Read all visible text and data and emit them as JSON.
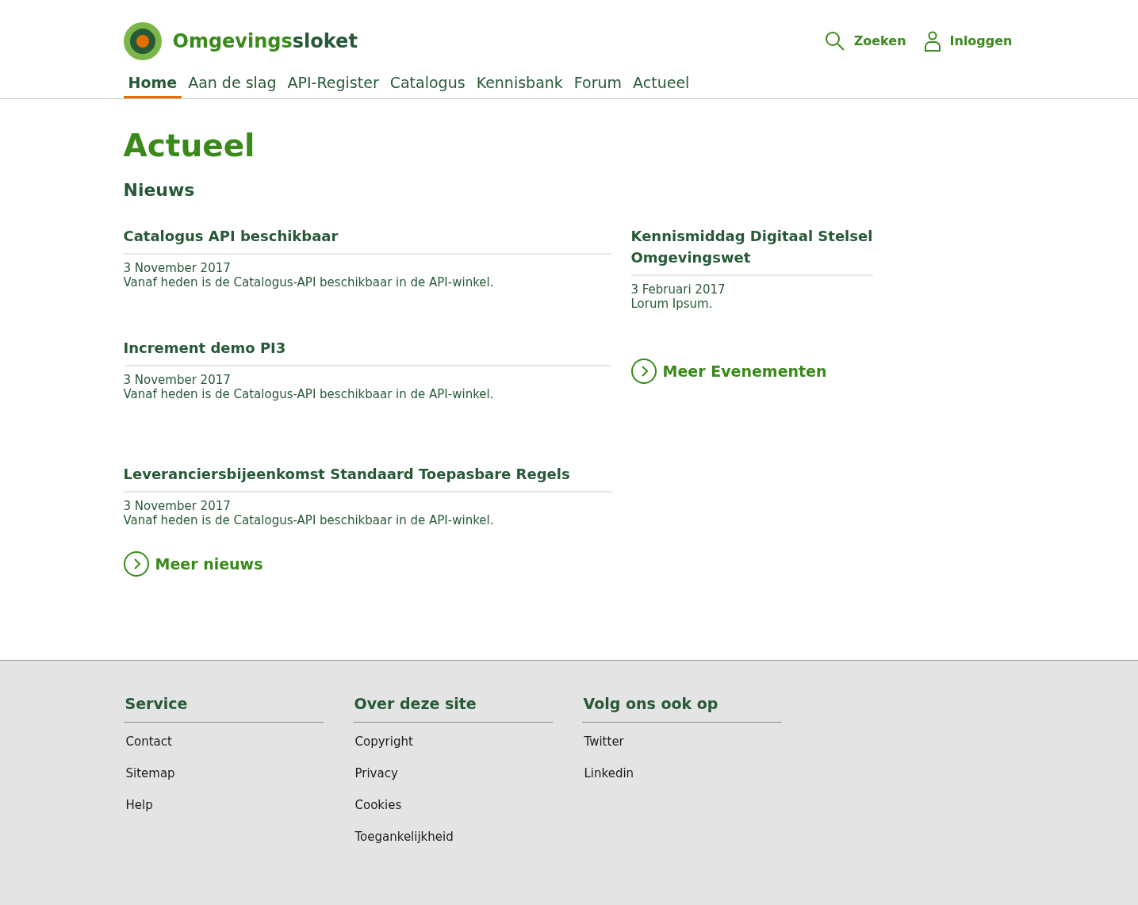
{
  "header": {
    "logo": {
      "part_1": "Omgevings",
      "part_2": "sloket"
    },
    "actions": [
      {
        "kind": "search",
        "label": "Zoeken"
      },
      {
        "kind": "user",
        "label": "Inloggen"
      }
    ],
    "nav": [
      {
        "label": "Home",
        "selected": true
      },
      {
        "label": "Aan de slag",
        "selected": false
      },
      {
        "label": "API-Register",
        "selected": false
      },
      {
        "label": "Catalogus",
        "selected": false
      },
      {
        "label": "Kennisbank",
        "selected": false
      },
      {
        "label": "Forum",
        "selected": false
      },
      {
        "label": "Actueel",
        "selected": false
      }
    ]
  },
  "page_title": "Actueel",
  "news": {
    "heading": "Nieuws",
    "items": [
      {
        "title": "Catalogus API beschikbaar",
        "date": "3 November 2017",
        "text": "Vanaf heden is de Catalogus-API beschikbaar in de API-winkel."
      },
      {
        "title": "Increment demo PI3",
        "date": "3 November 2017",
        "text": "Vanaf heden is de Catalogus-API beschikbaar in de API-winkel."
      },
      {
        "title": "Leveranciersbijeenkomst Standaard Toepasbare Regels",
        "date": "3 November 2017",
        "text": "Vanaf heden is de Catalogus-API beschikbaar in de API-winkel."
      }
    ],
    "more": "Meer nieuws"
  },
  "events": {
    "items": [
      {
        "title": "Kennismiddag Digitaal Stelsel Omgevingswet",
        "date": "3 Februari 2017",
        "text": "Lorum Ipsum."
      }
    ],
    "more": "Meer Evenementen"
  },
  "footer": {
    "columns": [
      {
        "heading": "Service",
        "links": [
          "Contact",
          "Sitemap",
          "Help"
        ]
      },
      {
        "heading": "Over deze site",
        "links": [
          "Copyright",
          "Privacy",
          "Cookies",
          "Toegankelijkheid"
        ]
      },
      {
        "heading": "Volg ons ook op",
        "links": [
          "Twitter",
          "Linkedin"
        ]
      }
    ]
  }
}
